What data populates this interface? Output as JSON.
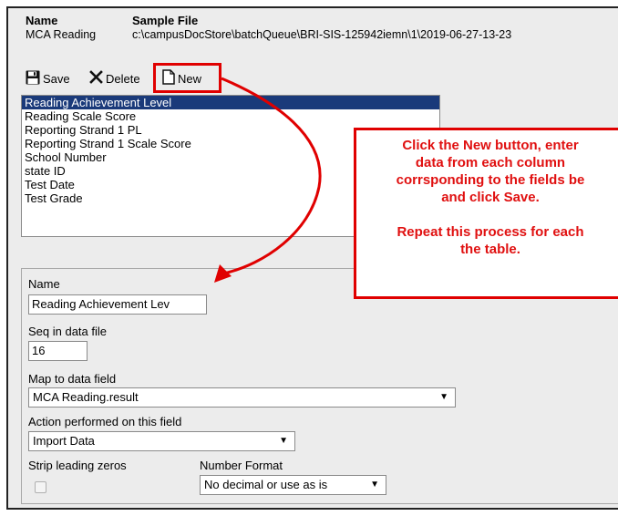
{
  "header": {
    "name_label": "Name",
    "name_value": "MCA Reading",
    "file_label": "Sample File",
    "file_value": "c:\\campusDocStore\\batchQueue\\BRI-SIS-125942iemn\\1\\2019-06-27-13-23"
  },
  "toolbar": {
    "save_label": "Save",
    "delete_label": "Delete",
    "new_label": "New"
  },
  "field_list": [
    "Reading Achievement Level",
    "Reading Scale Score",
    "Reporting Strand 1 PL",
    "Reporting Strand 1 Scale Score",
    "School Number",
    "state ID",
    "Test Date",
    "Test Grade"
  ],
  "callout": {
    "line1": "Click the New button, enter",
    "line2": "data from each column",
    "line3": "corrsponding to the fields be",
    "line4": "and click Save.",
    "line5": "Repeat this process for each",
    "line6": "the table."
  },
  "form": {
    "name_label": "Name",
    "name_value": "Reading Achievement Lev",
    "seq_label": "Seq in data file",
    "seq_value": "16",
    "map_label": "Map to data field",
    "map_value": "MCA Reading.result",
    "action_label": "Action performed on this field",
    "action_value": "Import Data",
    "strip_label": "Strip leading zeros",
    "number_format_label": "Number Format",
    "number_format_value": "No decimal or use as is"
  },
  "colors": {
    "annotation_red": "#e00000",
    "selected_row": "#1a3a7a"
  }
}
